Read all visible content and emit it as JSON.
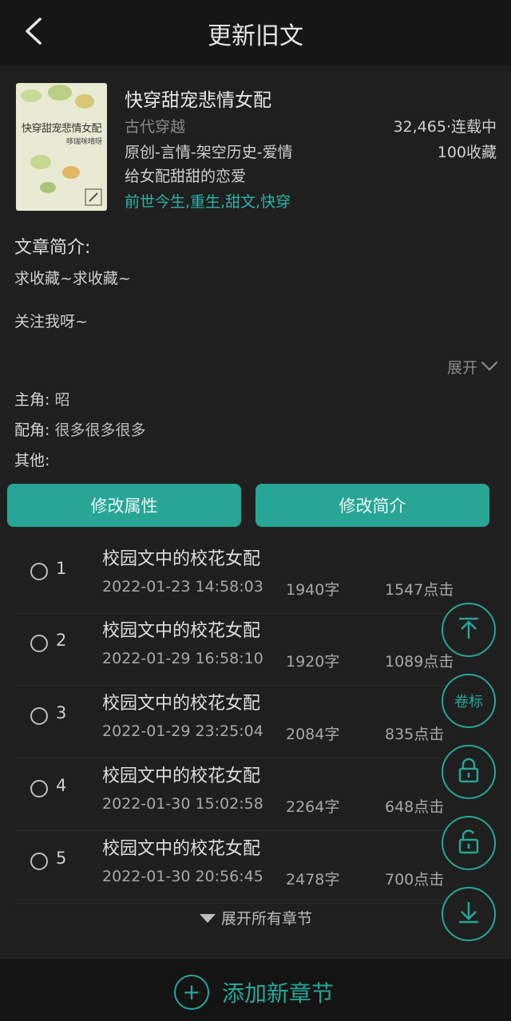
{
  "header": {
    "title": "更新旧文"
  },
  "book": {
    "cover_title": "快穿甜宠悲情女配",
    "cover_author": "哆瑞咪晴呀",
    "title": "快穿甜宠悲情女配",
    "category": "古代穿越",
    "stats": "32,465·连载中",
    "genre": "原创-言情-架空历史-爱情",
    "favorites": "100收藏",
    "tagline": "给女配甜甜的恋爱",
    "tags": "前世今生,重生,甜文,快穿"
  },
  "intro": {
    "title": "文章简介:",
    "line1": "求收藏~求收藏~",
    "line2": "关注我呀~",
    "expand_label": "展开"
  },
  "meta": {
    "protagonist_label": "主角:",
    "protagonist_value": "昭",
    "supporting_label": "配角:",
    "supporting_value": "很多很多很多",
    "other_label": "其他:",
    "other_value": ""
  },
  "buttons": {
    "edit_attributes": "修改属性",
    "edit_intro": "修改简介"
  },
  "chapters": [
    {
      "num": "1",
      "name": "校园文中的校花女配",
      "date": "2022-01-23 14:58:03",
      "words": "1940字",
      "clicks": "1547点击"
    },
    {
      "num": "2",
      "name": "校园文中的校花女配",
      "date": "2022-01-29 16:58:10",
      "words": "1920字",
      "clicks": "1089点击"
    },
    {
      "num": "3",
      "name": "校园文中的校花女配",
      "date": "2022-01-29 23:25:04",
      "words": "2084字",
      "clicks": "835点击"
    },
    {
      "num": "4",
      "name": "校园文中的校花女配",
      "date": "2022-01-30 15:02:58",
      "words": "2264字",
      "clicks": "648点击"
    },
    {
      "num": "5",
      "name": "校园文中的校花女配",
      "date": "2022-01-30 20:56:45",
      "words": "2478字",
      "clicks": "700点击"
    }
  ],
  "show_all_label": "展开所有章节",
  "fab": {
    "volume_label": "卷标"
  },
  "bottom": {
    "add_label": "添加新章节"
  },
  "colors": {
    "accent": "#27a696",
    "background": "#1f1f1f",
    "tags": "#2bb3a7"
  }
}
